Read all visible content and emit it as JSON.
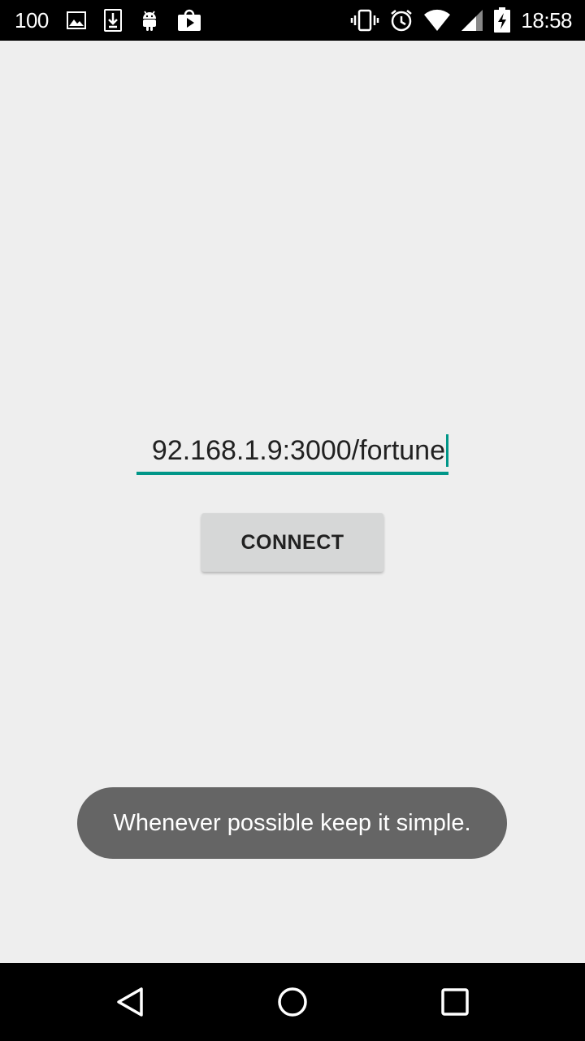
{
  "status_bar": {
    "battery_level_text": "100",
    "time": "18:58",
    "left_icons": [
      "image-icon",
      "download-icon",
      "android-icon",
      "play-store-icon"
    ],
    "right_icons": [
      "vibrate-icon",
      "alarm-icon",
      "wifi-icon",
      "cellular-icon",
      "battery-charging-icon"
    ]
  },
  "main": {
    "url_input_value": "92.168.1.9:3000/fortune",
    "connect_label": "CONNECT"
  },
  "toast": {
    "message": "Whenever possible keep it simple."
  },
  "nav_bar": {
    "buttons": [
      "back-icon",
      "home-icon",
      "recents-icon"
    ]
  },
  "colors": {
    "accent": "#009688",
    "background": "#eeeeee",
    "button": "#d6d7d7",
    "toast": "#656565"
  }
}
